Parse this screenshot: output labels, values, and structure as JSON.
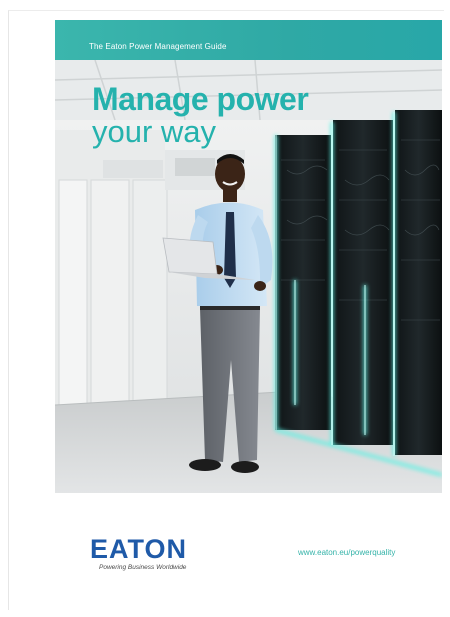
{
  "banner": {
    "text": "The Eaton Power Management Guide"
  },
  "headline": {
    "line1": "Manage power",
    "line2": "your way"
  },
  "logo": {
    "name": "EATON",
    "tagline": "Powering Business Worldwide"
  },
  "website": "www.eaton.eu/powerquality",
  "colors": {
    "accent": "#25b2ad",
    "brand_blue": "#1f5aa8",
    "banner": "#2fa9a5"
  },
  "photo": {
    "subject": "person-with-laptop-in-server-room-icon"
  }
}
